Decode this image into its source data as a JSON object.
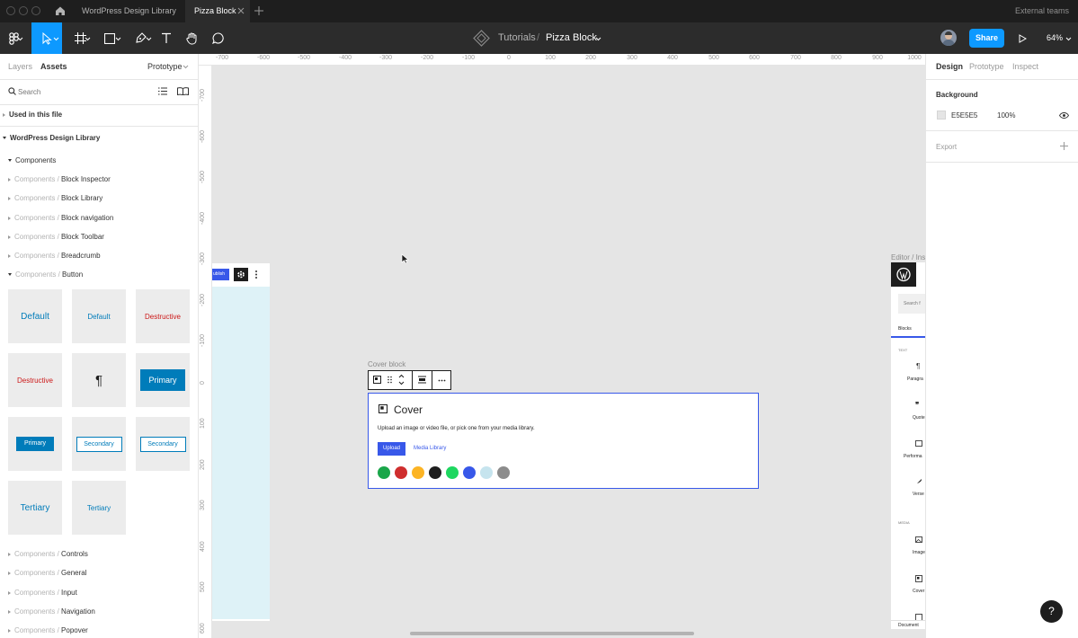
{
  "titlebar": {
    "tabs": [
      {
        "label": "WordPress Design Library"
      },
      {
        "label": "Pizza Block"
      }
    ],
    "team": "External teams"
  },
  "toolbar": {
    "breadcrumb_parent": "Tutorials",
    "breadcrumb_separator": "/",
    "file_name": "Pizza Block",
    "share_label": "Share",
    "zoom": "64%"
  },
  "left_panel": {
    "tabs": [
      "Layers",
      "Assets"
    ],
    "mode": "Prototype",
    "search_placeholder": "Search",
    "used_in_file": "Used in this file",
    "library": "WordPress Design Library",
    "components": "Components",
    "prefix": "Components /",
    "groups_top": [
      "Block Inspector",
      "Block Library",
      "Block navigation",
      "Block Toolbar",
      "Breadcrumb",
      "Button"
    ],
    "groups_bottom": [
      "Controls",
      "General",
      "Input",
      "Navigation",
      "Popover"
    ],
    "tiles": [
      "Default",
      "Default",
      "Destructive",
      "Destructive",
      "¶",
      "Primary",
      "Primary",
      "Secondary",
      "Secondary",
      "Tertiary",
      "Tertiary"
    ]
  },
  "canvas": {
    "ruler_top": [
      "-700",
      "-600",
      "-500",
      "-400",
      "-300",
      "-200",
      "-100",
      "0",
      "100",
      "200",
      "300",
      "400",
      "500",
      "600",
      "700",
      "800",
      "900",
      "1000"
    ],
    "ruler_left": [
      "-700",
      "-600",
      "-500",
      "-400",
      "-300",
      "-200",
      "-100",
      "0",
      "100",
      "200",
      "300",
      "400",
      "500",
      "600"
    ],
    "left_frame_button": "ublish",
    "cover_frame_label": "Cover block",
    "cover_title": "Cover",
    "cover_description": "Upload an image or video file, or pick one from your media library.",
    "upload_label": "Upload",
    "media_library_label": "Media Library",
    "swatches": [
      "#1aa64a",
      "#cf2e2e",
      "#fcb424",
      "#1e1e1e",
      "#1ed760",
      "#3858e9",
      "#c6e4ee",
      "#8c8c8c"
    ],
    "inserter_frame_label": "Editor / Ins",
    "inserter_search": "Search f",
    "inserter_tab": "Blocks",
    "inserter_text_heading": "TEXT",
    "inserter_text_items": [
      "Paragra",
      "Quote",
      "Performa",
      "Verse"
    ],
    "inserter_media_heading": "MEDIA",
    "inserter_media_items": [
      "Image",
      "Cover"
    ],
    "inserter_footer": "Document"
  },
  "right_panel": {
    "tabs": [
      "Design",
      "Prototype",
      "Inspect"
    ],
    "background_title": "Background",
    "background_hex": "E5E5E5",
    "background_opacity": "100%",
    "export_title": "Export"
  },
  "help_label": "?",
  "colors": {
    "accent": "#0d99ff",
    "wp_blue": "#3858e9",
    "wp_primary": "#007cba",
    "destructive": "#cc1818"
  }
}
